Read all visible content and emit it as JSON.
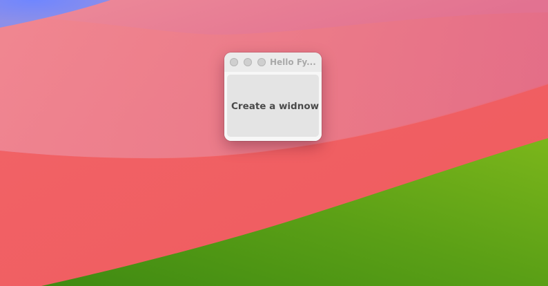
{
  "window": {
    "title": "Hello Fy...",
    "controls": {
      "close": "close-button",
      "minimize": "minimize-button",
      "zoom": "zoom-button"
    }
  },
  "content": {
    "button_label": "Create a widnow"
  },
  "colors": {
    "wallpaper_blue": "#7c8ef8",
    "wallpaper_pink": "#e06b8a",
    "wallpaper_salmon": "#f0616a",
    "wallpaper_green": "#4f9a1a",
    "window_bg": "#ececec",
    "button_bg": "#e4e4e4",
    "traffic_light_inactive": "#cfcfcf"
  }
}
